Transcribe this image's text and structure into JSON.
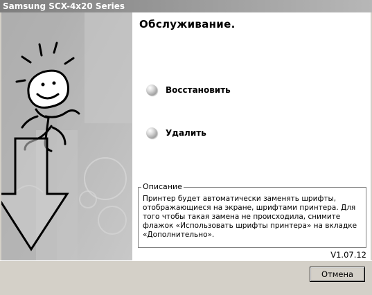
{
  "window": {
    "title": "Samsung SCX-4x20 Series"
  },
  "panel": {
    "heading": "Обслуживание.",
    "options": [
      {
        "label": "Восстановить",
        "icon": "sphere-bullet-icon"
      },
      {
        "label": "Удалить",
        "icon": "sphere-bullet-icon"
      }
    ],
    "description": {
      "legend": "Описание",
      "text": "Принтер будет автоматически заменять шрифты, отображающиеся на экране, шрифтами принтера. Для того чтобы такая замена не происходила, снимите флажок «Использовать шрифты принтера» на вкладке «Дополнительно»."
    },
    "version": "V1.07.12"
  },
  "footer": {
    "cancel_label": "Отмена"
  },
  "colors": {
    "titlebar_start": "#7e7e7e",
    "titlebar_end": "#b7b7b7",
    "dialog_face": "#d4d0c8"
  }
}
